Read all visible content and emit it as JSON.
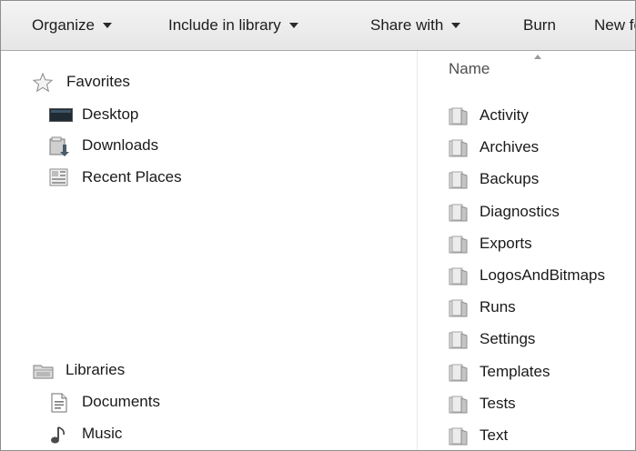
{
  "toolbar": {
    "organize": "Organize",
    "include_in_library": "Include in library",
    "share_with": "Share with",
    "burn": "Burn",
    "new_folder": "New folder"
  },
  "nav": {
    "favorites": {
      "label": "Favorites",
      "items": [
        {
          "label": "Desktop",
          "icon": "desktop-icon"
        },
        {
          "label": "Downloads",
          "icon": "downloads-icon"
        },
        {
          "label": "Recent Places",
          "icon": "recent-places-icon"
        }
      ]
    },
    "libraries": {
      "label": "Libraries",
      "items": [
        {
          "label": "Documents",
          "icon": "documents-icon"
        },
        {
          "label": "Music",
          "icon": "music-icon"
        }
      ]
    }
  },
  "content": {
    "column_name": "Name",
    "folders": [
      "Activity",
      "Archives",
      "Backups",
      "Diagnostics",
      "Exports",
      "LogosAndBitmaps",
      "Runs",
      "Settings",
      "Templates",
      "Tests",
      "Text"
    ]
  }
}
